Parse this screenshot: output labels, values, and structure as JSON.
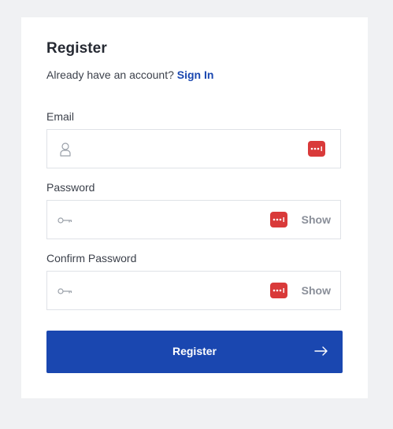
{
  "form": {
    "title": "Register",
    "signin_prompt": "Already have an account?",
    "signin_link": "Sign In",
    "email_label": "Email",
    "email_value": "",
    "password_label": "Password",
    "password_value": "",
    "password_show": "Show",
    "confirm_label": "Confirm Password",
    "confirm_value": "",
    "confirm_show": "Show",
    "submit_label": "Register"
  },
  "icons": {
    "email_field": "user-icon",
    "password_field": "key-icon",
    "password_manager": "password-manager-icon",
    "submit_arrow": "arrow-right-icon"
  },
  "colors": {
    "accent": "#1a47b0",
    "password_manager": "#d93a3a",
    "page_background": "#f0f1f3"
  }
}
